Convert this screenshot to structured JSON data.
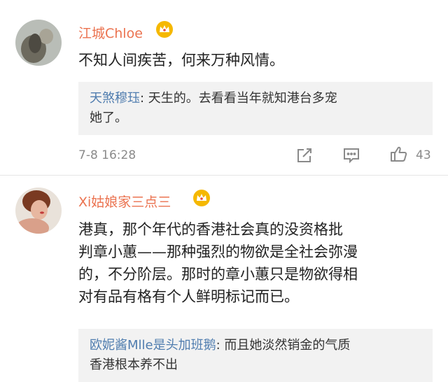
{
  "comments": [
    {
      "username": "江城Chloe",
      "badge_icon": "crown-vip-icon",
      "text": "不知人间疾苦，何来万种风情。",
      "reply": {
        "user": "天煞穆珏",
        "separator": ": ",
        "text_line1": "天生的。去看看当年就知港台多宠",
        "text_line2": "她了。"
      },
      "time": "7-8 16:28",
      "likes": "43",
      "actions": [
        "share-icon",
        "comment-icon",
        "like-icon"
      ]
    },
    {
      "username": "Xi姑娘家三点三",
      "badge_icon": "crown-vip-icon",
      "text_lines": [
        "港真，那个年代的香港社会真的没资格批",
        "判章小蕙——那种强烈的物欲是全社会弥漫",
        "的，不分阶层。那时的章小蕙只是物欲得相",
        "对有品有格有个人鲜明标记而已。"
      ],
      "reply": {
        "user": "欧妮酱Mlle是头加班鹅",
        "separator": ": ",
        "text_line1": "而且她淡然销金的气质",
        "text_line2": "香港根本养不出"
      }
    }
  ],
  "colors": {
    "username": "#eb7350",
    "reply_user": "#507daf",
    "reply_bg": "#f2f2f2",
    "meta": "#8a8a8a",
    "crown": "#f5b800",
    "crown_gem": "#e84a3a"
  }
}
